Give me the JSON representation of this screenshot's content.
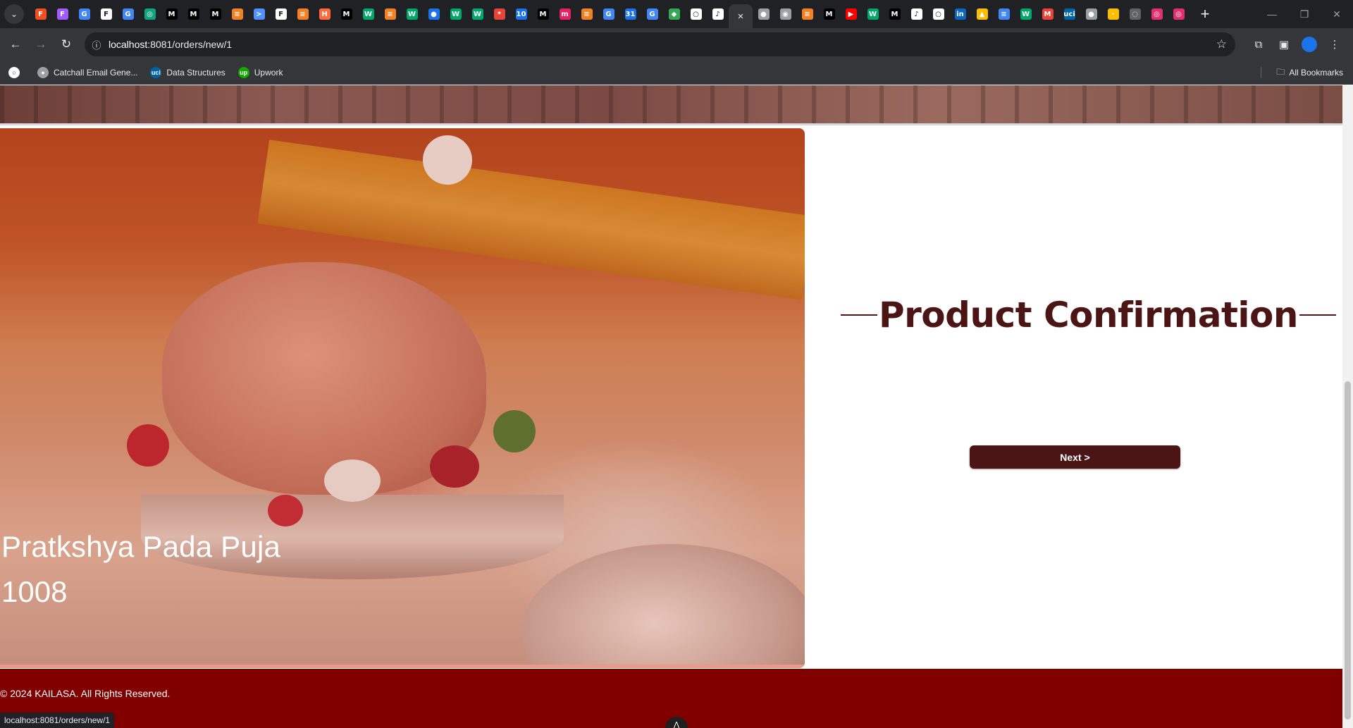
{
  "browser": {
    "tabs_favicons": [
      {
        "icon": "figma-icon",
        "color": "#f24e1e",
        "glyph": "F"
      },
      {
        "icon": "figma-icon",
        "color": "#a259ff",
        "glyph": "F"
      },
      {
        "icon": "google-icon",
        "color": "#4285f4",
        "glyph": "G"
      },
      {
        "icon": "framer-icon",
        "color": "#ffffff",
        "glyph": "F"
      },
      {
        "icon": "google-icon",
        "color": "#4285f4",
        "glyph": "G"
      },
      {
        "icon": "chatgpt-icon",
        "color": "#10a37f",
        "glyph": "◎"
      },
      {
        "icon": "medium-icon",
        "color": "#000000",
        "glyph": "M"
      },
      {
        "icon": "medium-icon",
        "color": "#000000",
        "glyph": "M"
      },
      {
        "icon": "medium-icon",
        "color": "#000000",
        "glyph": "M"
      },
      {
        "icon": "stackoverflow-icon",
        "color": "#f48024",
        "glyph": "≡"
      },
      {
        "icon": "powershell-icon",
        "color": "#5391fe",
        "glyph": ">"
      },
      {
        "icon": "framer-icon",
        "color": "#ffffff",
        "glyph": "F"
      },
      {
        "icon": "stackoverflow-icon",
        "color": "#f48024",
        "glyph": "≡"
      },
      {
        "icon": "hackerrank-icon",
        "color": "#ff6d3f",
        "glyph": "H"
      },
      {
        "icon": "medium-icon",
        "color": "#000000",
        "glyph": "M"
      },
      {
        "icon": "wordpress-w-icon",
        "color": "#00a86b",
        "glyph": "W"
      },
      {
        "icon": "stackoverflow-icon",
        "color": "#f48024",
        "glyph": "≡"
      },
      {
        "icon": "wordpress-w-icon",
        "color": "#00a86b",
        "glyph": "W"
      },
      {
        "icon": "globe-icon",
        "color": "#1a73e8",
        "glyph": "●"
      },
      {
        "icon": "wordpress-w-icon",
        "color": "#00a86b",
        "glyph": "W"
      },
      {
        "icon": "wordpress-w-icon",
        "color": "#00a86b",
        "glyph": "W"
      },
      {
        "icon": "asterisk-icon",
        "color": "#ea4335",
        "glyph": "*"
      },
      {
        "icon": "calendar-icon",
        "color": "#1a73e8",
        "glyph": "10"
      },
      {
        "icon": "medium-icon",
        "color": "#000000",
        "glyph": "M"
      },
      {
        "icon": "miro-icon",
        "color": "#e91e63",
        "glyph": "m"
      },
      {
        "icon": "stackoverflow-icon",
        "color": "#f48024",
        "glyph": "≡"
      },
      {
        "icon": "google-icon",
        "color": "#4285f4",
        "glyph": "G"
      },
      {
        "icon": "calendar-icon",
        "color": "#1a73e8",
        "glyph": "31"
      },
      {
        "icon": "google-icon",
        "color": "#4285f4",
        "glyph": "G"
      },
      {
        "icon": "maps-icon",
        "color": "#34a853",
        "glyph": "◆"
      },
      {
        "icon": "github-icon",
        "color": "#ffffff",
        "glyph": "○"
      },
      {
        "icon": "tiktok-icon",
        "color": "#ffffff",
        "glyph": "♪"
      }
    ],
    "tabs_favicons_after": [
      {
        "icon": "globe-icon",
        "color": "#9aa0a6",
        "glyph": "●"
      },
      {
        "icon": "chrome-icon",
        "color": "#9aa0a6",
        "glyph": "◉"
      },
      {
        "icon": "stackoverflow-icon",
        "color": "#f48024",
        "glyph": "≡"
      },
      {
        "icon": "medium-icon",
        "color": "#000000",
        "glyph": "M"
      },
      {
        "icon": "youtube-icon",
        "color": "#ff0000",
        "glyph": "▶"
      },
      {
        "icon": "wordpress-w-icon",
        "color": "#00a86b",
        "glyph": "W"
      },
      {
        "icon": "medium-icon",
        "color": "#000000",
        "glyph": "M"
      },
      {
        "icon": "tiktok-icon",
        "color": "#ffffff",
        "glyph": "♪"
      },
      {
        "icon": "github-icon",
        "color": "#ffffff",
        "glyph": "○"
      },
      {
        "icon": "linkedin-icon",
        "color": "#0a66c2",
        "glyph": "in"
      },
      {
        "icon": "drive-icon",
        "color": "#fbbc04",
        "glyph": "▲"
      },
      {
        "icon": "docs-icon",
        "color": "#4285f4",
        "glyph": "≡"
      },
      {
        "icon": "wordpress-w-icon",
        "color": "#00a86b",
        "glyph": "W"
      },
      {
        "icon": "gmail-icon",
        "color": "#ea4335",
        "glyph": "M"
      },
      {
        "icon": "uci-icon",
        "color": "#0064a4",
        "glyph": "uci"
      },
      {
        "icon": "globe-icon",
        "color": "#9aa0a6",
        "glyph": "●"
      },
      {
        "icon": "dot-icon",
        "color": "#fbbc04",
        "glyph": "·"
      },
      {
        "icon": "blank-icon",
        "color": "#5f6368",
        "glyph": "◌"
      },
      {
        "icon": "instagram-icon",
        "color": "#e1306c",
        "glyph": "◎"
      },
      {
        "icon": "instagram-icon",
        "color": "#e1306c",
        "glyph": "◎"
      }
    ],
    "active_tab_close": "×",
    "new_tab": "+",
    "url_host": "localhost",
    "url_rest": ":8081/orders/new/1",
    "bookmarks": [
      {
        "label": "Catchall Email Gene...",
        "icon": "globe-icon",
        "color": "#9aa0a6",
        "glyph": "●"
      },
      {
        "label": "Data Structures",
        "icon": "uci-icon",
        "color": "#0064a4",
        "glyph": "uci"
      },
      {
        "label": "Upwork",
        "icon": "upwork-icon",
        "color": "#14a800",
        "glyph": "up"
      }
    ],
    "all_bookmarks": "All Bookmarks",
    "status_url": "localhost:8081/orders/new/1"
  },
  "page": {
    "hero": {
      "title": "Pratkshya Pada Puja",
      "price": "1008"
    },
    "confirmation": {
      "heading": "Product Confirmation",
      "next_button": "Next >"
    },
    "footer": {
      "copyright": "© 2024 KAILASA. All Rights Reserved."
    }
  },
  "colors": {
    "brand_maroon": "#4b1515",
    "footer_bg": "#800000"
  }
}
